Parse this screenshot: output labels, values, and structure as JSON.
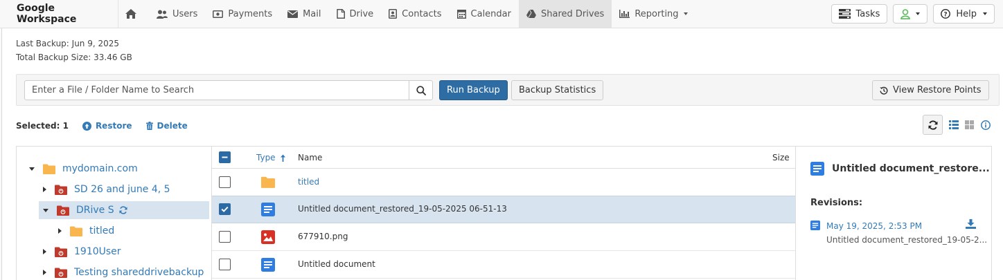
{
  "nav": {
    "brand": "Google Workspace",
    "items": [
      {
        "label": "Users",
        "icon": "users-icon"
      },
      {
        "label": "Payments",
        "icon": "payments-icon"
      },
      {
        "label": "Mail",
        "icon": "mail-icon"
      },
      {
        "label": "Drive",
        "icon": "file-icon"
      },
      {
        "label": "Contacts",
        "icon": "contacts-icon"
      },
      {
        "label": "Calendar",
        "icon": "calendar-icon"
      },
      {
        "label": "Shared Drives",
        "icon": "shared-drive-icon",
        "active": true
      },
      {
        "label": "Reporting",
        "icon": "bar-chart-icon"
      }
    ],
    "tasks_label": "Tasks",
    "help_label": "Help"
  },
  "backup": {
    "last_backup": "Last Backup: Jun 9, 2025",
    "total_size": "Total Backup Size: 33.46 GB"
  },
  "toolbar": {
    "search_placeholder": "Enter a File / Folder Name to Search",
    "run_backup": "Run Backup",
    "backup_statistics": "Backup Statistics",
    "view_restore_points": "View Restore Points"
  },
  "selection": {
    "selected_text": "Selected: 1",
    "restore": "Restore",
    "delete": "Delete"
  },
  "tree": [
    {
      "label": "mydomain.com",
      "type": "folder",
      "expanded": true
    },
    {
      "label": "SD 26 and june 4, 5",
      "type": "drive"
    },
    {
      "label": "DRive S",
      "type": "drive",
      "expanded": true,
      "selected": true
    },
    {
      "label": "titled",
      "type": "folder"
    },
    {
      "label": "1910User",
      "type": "drive"
    },
    {
      "label": "Testing shareddrivebackup",
      "type": "drive"
    }
  ],
  "files": {
    "headers": {
      "type": "Type",
      "name": "Name",
      "size": "Size"
    },
    "rows": [
      {
        "name": "titled",
        "icon": "folder-icon",
        "checked": false
      },
      {
        "name": "Untitled document_restored_19-05-2025 06-51-13",
        "icon": "document-icon",
        "checked": true
      },
      {
        "name": "677910.png",
        "icon": "image-icon",
        "checked": false
      },
      {
        "name": "Untitled document",
        "icon": "document-icon",
        "checked": false
      }
    ]
  },
  "details": {
    "title": "Untitled document_restore...",
    "revisions_label": "Revisions:",
    "revision_date": "May 19, 2025, 2:53 PM",
    "revision_name": "Untitled document_restored_19-05-2..."
  },
  "colors": {
    "link": "#337ab7",
    "primary": "#2e6da4",
    "folder": "#f9b64f",
    "drive": "#c0392b",
    "doc": "#2f7de1",
    "image": "#d93025",
    "success": "#5cb85c"
  }
}
